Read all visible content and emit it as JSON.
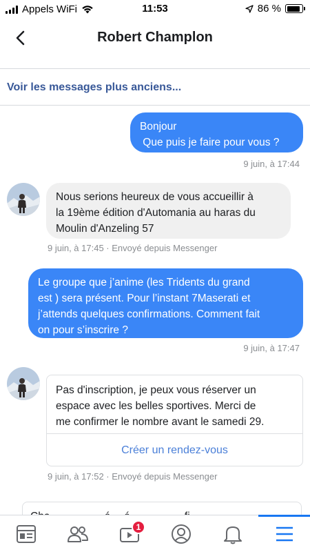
{
  "status_bar": {
    "carrier": "Appels WiFi",
    "time": "11:53",
    "battery": "86 %",
    "battery_level": 0.86
  },
  "header": {
    "title": "Robert Champlon"
  },
  "older_messages_link": "Voir les messages plus anciens...",
  "messages": [
    {
      "direction": "outgoing",
      "lines": [
        "Bonjour",
        " Que puis je faire pour vous ?"
      ],
      "meta": "9 juin, à 17:44"
    },
    {
      "direction": "incoming",
      "lines": [
        "Nous serions heureux de vous accueillir à",
        "la 19ème édition d'Automania au haras du",
        "Moulin d'Anzeling 57"
      ],
      "meta": "9 juin, à 17:45 · Envoyé depuis Messenger"
    },
    {
      "direction": "outgoing",
      "lines": [
        "Le groupe que j’anime (les Tridents du grand",
        "est ) sera présent. Pour l’instant 7Maserati et",
        "j’attends quelques confirmations. Comment fait",
        "on pour s’inscrire ?"
      ],
      "meta": "9 juin, à 17:47"
    },
    {
      "direction": "incoming",
      "lines": [
        "Pas d'inscription, je peux vous réserver un",
        "espace avec les belles sportives. Merci de",
        "me confirmer le nombre avant le samedi 29."
      ],
      "action": "Créer un rendez-vous",
      "meta": "9 juin, à 17:52 · Envoyé depuis Messenger"
    }
  ],
  "partial_message": "Cha… … … … é… é… … … … fi… …",
  "bottom_nav": {
    "items": [
      {
        "icon": "news-feed-icon"
      },
      {
        "icon": "friends-icon"
      },
      {
        "icon": "watch-icon",
        "badge": "1"
      },
      {
        "icon": "profile-icon"
      },
      {
        "icon": "bell-icon"
      },
      {
        "icon": "menu-icon",
        "active": true
      }
    ]
  },
  "colors": {
    "outgoing_bubble": "#3a86f7",
    "incoming_bubble": "#f0f0f0",
    "link": "#385898",
    "action": "#4a7fd8",
    "active_tab": "#1877f2",
    "badge": "#e41e3f"
  }
}
